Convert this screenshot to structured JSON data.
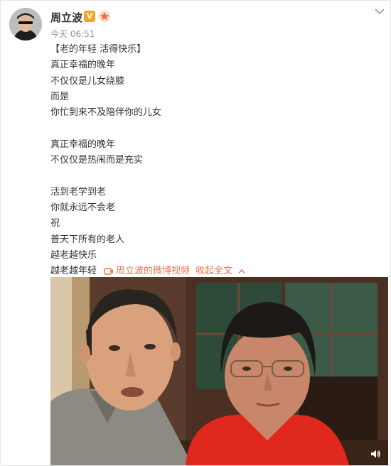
{
  "post": {
    "author": "周立波",
    "verified_badge": "V",
    "time": "今天 06:51",
    "lines": [
      "【老的年轻 活得快乐】",
      "真正幸福的晚年",
      "不仅仅是儿女绕膝",
      "而是",
      "你忙到来不及陪伴你的儿女",
      "",
      "真正幸福的晚年",
      "不仅仅是热闹而是充实",
      "",
      "活到老学到老",
      "你就永远不会老",
      "祝",
      "普天下所有的老人",
      "越老越快乐"
    ],
    "last_line": "越老越年轻",
    "video_link": "周立波的微博视频",
    "collapse": "收起全文"
  },
  "colors": {
    "link": "#eb7350",
    "timestamp": "#939393",
    "text": "#333333",
    "verified": "#f5a623"
  },
  "icons": {
    "verified": "verified-badge-icon",
    "level": "fan-level-icon",
    "more": "chevron-down-icon",
    "video": "video-camera-icon",
    "collapse": "chevron-up-icon",
    "volume": "volume-icon"
  }
}
